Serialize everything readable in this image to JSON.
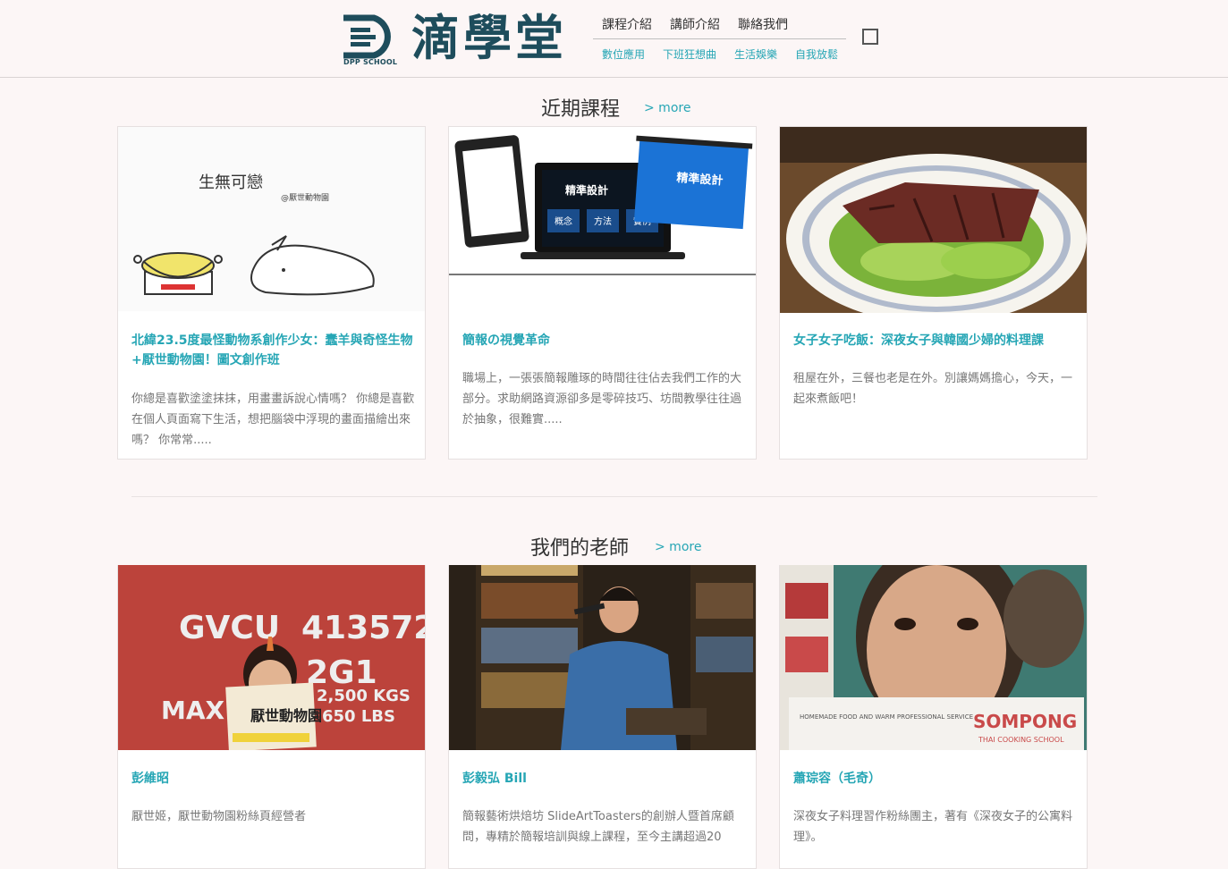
{
  "brand": {
    "name": "滴學堂",
    "sub": "DPP SCHOOL",
    "primary_color": "#1e4d5c",
    "accent_color": "#26a6b5"
  },
  "nav": {
    "main": [
      "課程介紹",
      "講師介紹",
      "聯絡我們"
    ],
    "sub": [
      "數位應用",
      "下班狂想曲",
      "生活娛樂",
      "自我放鬆"
    ]
  },
  "courses": {
    "title": "近期課程",
    "more": "> more",
    "items": [
      {
        "title": "北緯23.5度最怪動物系創作少女：蠢羊與奇怪生物+厭世動物園！圖文創作班",
        "desc": "你總是喜歡塗塗抹抹，用畫畫訴說心情嗎？ 你總是喜歡在個人頁面寫下生活，想把腦袋中浮現的畫面描繪出來嗎？ 你常常.....",
        "image": "illustration-pot-and-bird",
        "image_text": "生無可戀",
        "image_text2": "@厭世動物園"
      },
      {
        "title": "簡報の視覺革命",
        "desc": "職場上，一張張簡報雕琢的時間往往佔去我們工作的大部分。求助網路資源卻多是零碎技巧、坊間教學往往過於抽象，很難實.....",
        "image": "devices-presentation-mockup",
        "image_text": "精準設計",
        "image_labels": [
          "概念",
          "方法",
          "實例"
        ]
      },
      {
        "title": "女子女子吃飯：深夜女子與韓國少婦的料理課",
        "desc": "租屋在外，三餐也老是在外。別讓媽媽擔心，今天，一起來煮飯吧！",
        "image": "steak-salad-photo"
      }
    ]
  },
  "teachers": {
    "title": "我們的老師",
    "more": "> more",
    "items": [
      {
        "name": "彭維昭",
        "desc": "厭世姬，厭世動物園粉絲頁經營者",
        "image": "woman-holding-book-photo",
        "image_texts": [
          "GVCU",
          "413572",
          "2G1",
          "MAX. GR",
          "2,500 KGS",
          "650 LBS",
          "厭世動物園"
        ]
      },
      {
        "name": "彭毅弘 Bill",
        "desc": "簡報藝術烘焙坊 SlideArtToasters的創辦人暨首席顧問，專精於簡報培訓與線上課程，至今主講超過20",
        "image": "man-speaking-microphone-photo"
      },
      {
        "name": "蕭琮容（毛奇）",
        "desc": "深夜女子料理習作粉絲團主，著有《深夜女子的公寓料理》。",
        "image": "woman-with-cooking-school-book-photo",
        "image_texts": [
          "SOMPONG",
          "THAI COOKING SCHOOL",
          "HOMEMADE FOOD AND WARM PROFESSIONAL SERVICE"
        ]
      }
    ]
  }
}
